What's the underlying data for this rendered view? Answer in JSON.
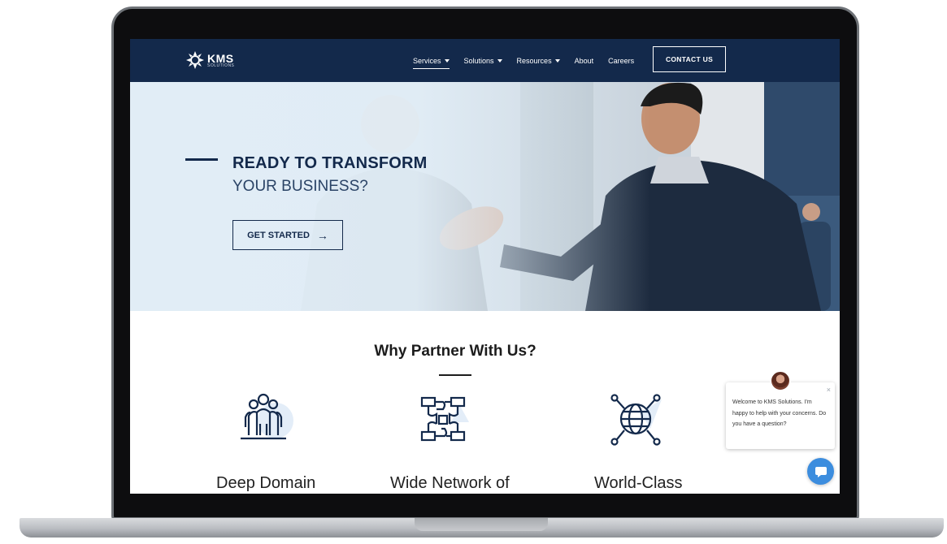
{
  "brand": {
    "name": "KMS",
    "sub": "SOLUTIONS"
  },
  "nav": {
    "items": [
      {
        "label": "Services",
        "dropdown": true,
        "active": true
      },
      {
        "label": "Solutions",
        "dropdown": true
      },
      {
        "label": "Resources",
        "dropdown": true
      },
      {
        "label": "About"
      },
      {
        "label": "Careers"
      }
    ],
    "cta": "CONTACT US"
  },
  "hero": {
    "title": "READY TO TRANSFORM",
    "subtitle": "YOUR BUSINESS?",
    "button": "GET STARTED",
    "arrow": "→"
  },
  "why": {
    "title": "Why Partner With Us?",
    "features": [
      {
        "label": "Deep Domain",
        "icon": "team-people-icon"
      },
      {
        "label": "Wide Network of",
        "icon": "connected-hands-icon"
      },
      {
        "label": "World-Class",
        "icon": "globe-network-icon"
      }
    ]
  },
  "chat": {
    "message": "Welcome to KMS Solutions. I'm happy to help with your concerns. Do you have a question?",
    "close": "×"
  },
  "colors": {
    "navy": "#13294b",
    "hero_bg": "#dde7ef",
    "chat_blue": "#3c8dde"
  }
}
